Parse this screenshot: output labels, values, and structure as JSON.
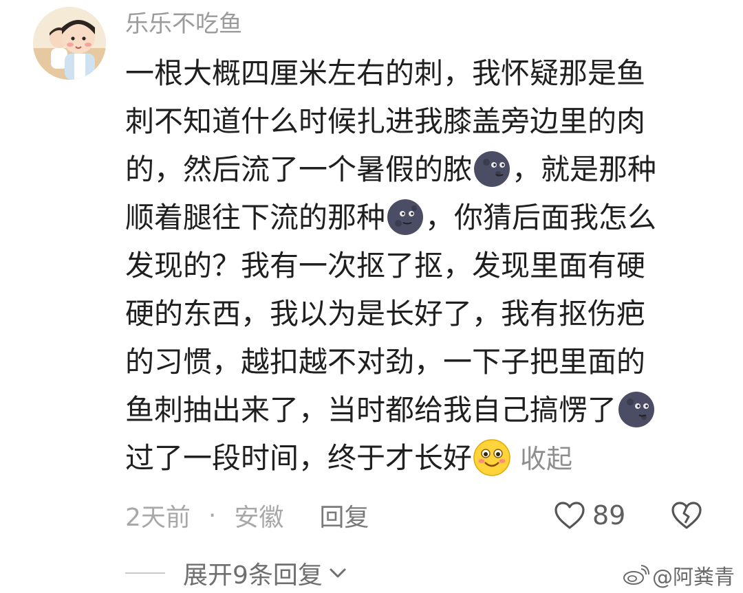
{
  "comment": {
    "username": "乐乐不吃鱼",
    "lines": [
      "一根大概四厘米左右的刺，我怀疑那是鱼",
      "刺不知道什么时候扎进我膝盖旁边里的肉",
      "的，然后流了一个暑假的脓",
      "，就是那种",
      "顺着腿往下流的那种",
      "，你猜后面我怎么",
      "发现的？我有一次抠了抠，发现里面有硬",
      "硬的东西，我以为是长好了，我有抠伤疤",
      "的习惯，越扣越不对劲，一下子把里面的",
      "鱼刺抽出来了，当时都给我自己搞愣了",
      "过了一段时间，终于才长好"
    ],
    "collapse_label": "收起",
    "time": "2天前",
    "separator": "·",
    "location": "安徽",
    "reply_label": "回复",
    "like_count": "89",
    "expand_label": "展开9条回复"
  },
  "watermark": "@阿粪青",
  "icons": {
    "emoji_1": "new-moon-face",
    "emoji_2": "new-moon-face",
    "emoji_3": "new-moon-face",
    "emoji_4": "smiling-face",
    "like": "heart-outline-icon",
    "dislike": "broken-heart-icon",
    "expand": "chevron-down-icon",
    "watermark": "weibo-logo-icon"
  }
}
